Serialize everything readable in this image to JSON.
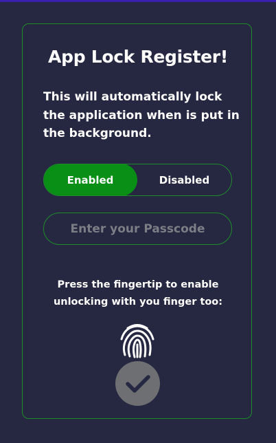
{
  "screen": {
    "title": "App Lock Register!",
    "description": "This will automatically lock the application when is put in the background."
  },
  "toggle": {
    "options": [
      "Enabled",
      "Disabled"
    ],
    "selected": "Enabled"
  },
  "passcode": {
    "placeholder": "Enter your Passcode",
    "value": ""
  },
  "fingerprint": {
    "note": "Press the fingertip to enable unlocking with you finger too:",
    "icon": "fingerprint-icon"
  },
  "confirm": {
    "icon": "checkmark-icon"
  },
  "colors": {
    "background": "#262841",
    "accent": "#0a8f16",
    "border": "#1f8c2b",
    "top_bar": "#3b1fae",
    "confirm_button": "#6e6f72"
  }
}
